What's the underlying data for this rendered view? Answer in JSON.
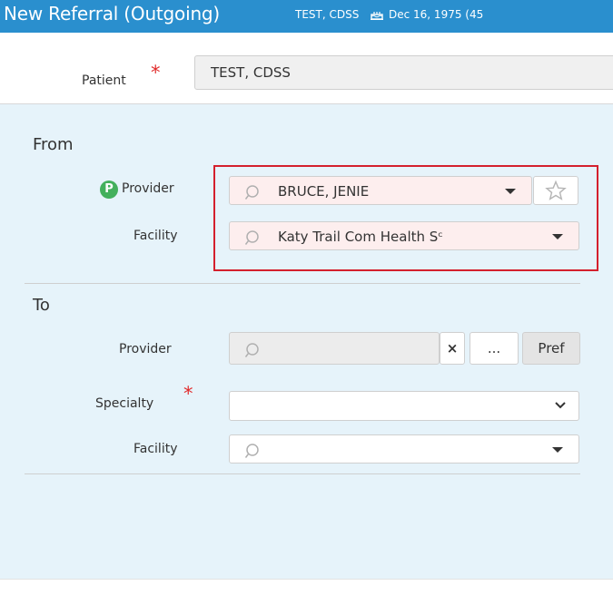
{
  "header": {
    "title": "New Referral (Outgoing)",
    "patient_name": "TEST, CDSS",
    "dob": "Dec 16, 1975 (45"
  },
  "patient": {
    "label": "Patient",
    "required_mark": "*",
    "value": "TEST, CDSS"
  },
  "from": {
    "title": "From",
    "provider_badge": "P",
    "provider_label": "Provider",
    "provider_value": "BRUCE, JENIE",
    "facility_label": "Facility",
    "facility_value": "Katy Trail Com Health Sᶜ"
  },
  "to": {
    "title": "To",
    "provider_label": "Provider",
    "provider_value": "",
    "clear_button": "×",
    "more_button": "...",
    "pref_button": "Pref",
    "specialty_label": "Specialty",
    "specialty_required_mark": "*",
    "specialty_value": "",
    "facility_label": "Facility",
    "facility_value": ""
  },
  "colors": {
    "header_bg": "#2a8fce",
    "panel_bg": "#e6f3fa",
    "highlight": "#d4202d",
    "required": "#e12b2b",
    "badge": "#43b05c"
  }
}
